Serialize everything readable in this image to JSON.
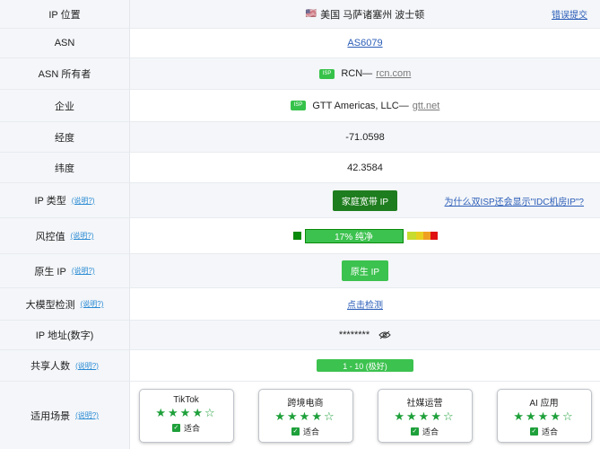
{
  "rows": {
    "ip_location": {
      "label": "IP 位置",
      "flag": "🇺🇸",
      "value": "美国 马萨诸塞州 波士顿",
      "report_link": "错误提交"
    },
    "asn": {
      "label": "ASN",
      "value": "AS6079"
    },
    "asn_owner": {
      "label": "ASN 所有者",
      "badge": "ISP",
      "name": "RCN—",
      "domain": "rcn.com"
    },
    "enterprise": {
      "label": "企业",
      "badge": "ISP",
      "name": "GTT Americas, LLC—",
      "domain": "gtt.net"
    },
    "longitude": {
      "label": "经度",
      "value": "-71.0598"
    },
    "latitude": {
      "label": "纬度",
      "value": "42.3584"
    },
    "ip_type": {
      "label": "IP 类型",
      "help": "(说明?)",
      "value": "家庭宽带 IP",
      "side_link": "为什么双ISP还会显示\"IDC机房IP\"?"
    },
    "risk": {
      "label": "风控值",
      "help": "(说明?)",
      "value": "17%   纯净",
      "percent": 17
    },
    "native_ip": {
      "label": "原生 IP",
      "help": "(说明?)",
      "value": "原生 IP"
    },
    "llm_check": {
      "label": "大模型检测",
      "help": "(说明?)",
      "value": "点击检测"
    },
    "ip_numeric": {
      "label": "IP 地址(数字)",
      "value": "********"
    },
    "shared_users": {
      "label": "共享人数",
      "help": "(说明?)",
      "value": "1 - 10 (极好)"
    },
    "use_cases": {
      "label": "适用场景",
      "help": "(说明?)",
      "cards": [
        {
          "title": "TikTok",
          "stars": "★★★★☆",
          "rating": 4,
          "fit": "适合"
        },
        {
          "title": "跨境电商",
          "stars": "★★★★☆",
          "rating": 4,
          "fit": "适合"
        },
        {
          "title": "社媒运营",
          "stars": "★★★★☆",
          "rating": 4,
          "fit": "适合"
        },
        {
          "title": "AI 应用",
          "stars": "★★★★☆",
          "rating": 4,
          "fit": "适合"
        }
      ]
    }
  },
  "colors": {
    "accent_green": "#3cc24f",
    "dark_green": "#1e7d1e",
    "link_blue": "#2b5db8",
    "help_blue": "#2a8bd4",
    "risk_gradient": [
      "#c7dc2e",
      "#e8d020",
      "#f0a020",
      "#e01010"
    ]
  }
}
